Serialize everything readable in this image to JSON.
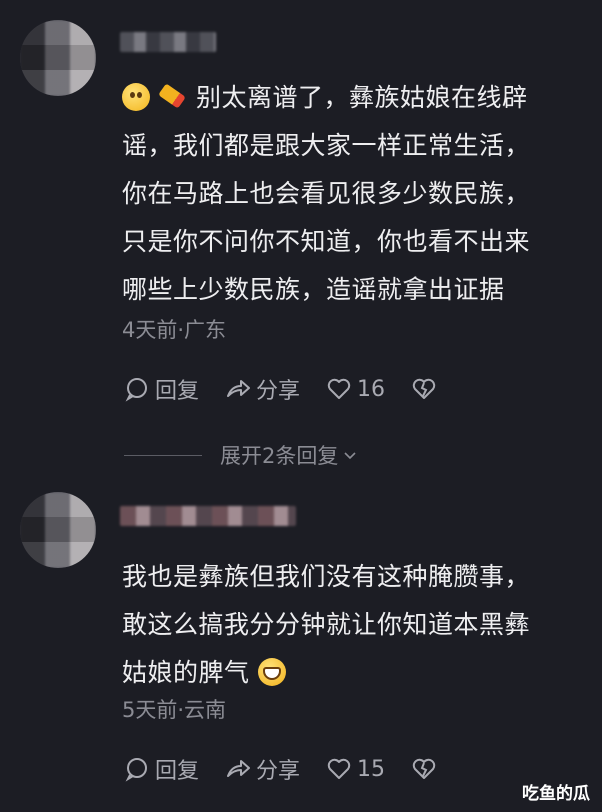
{
  "comments": [
    {
      "text_line1": "别太离谱了，彝族姑娘在线辟",
      "lines": [
        "谣，我们都是跟大家一样正常生活，",
        "你在马路上也会看见很多少数民族，",
        "只是你不问你不知道，你也看不出来",
        "哪些上少数民族，造谣就拿出证据"
      ],
      "emoji_names": [
        "smiling-face-emoji",
        "label-tag-emoji"
      ],
      "meta": "4天前·广东",
      "reply_label": "回复",
      "share_label": "分享",
      "like_count": "16"
    },
    {
      "lines": [
        "我也是彝族但我们没有这种腌臜事，",
        "敢这么搞我分分钟就让你知道本黑彝",
        "姑娘的脾气"
      ],
      "emoji_names": [
        "grinning-face-emoji"
      ],
      "meta": "5天前·云南",
      "reply_label": "回复",
      "share_label": "分享",
      "like_count": "15"
    }
  ],
  "expand_replies": "展开2条回复",
  "watermark": "吃鱼的瓜",
  "colors": {
    "background": "#1c1d24",
    "text": "#eeeef0",
    "meta": "#8b8c94",
    "action": "#a9aab2"
  }
}
